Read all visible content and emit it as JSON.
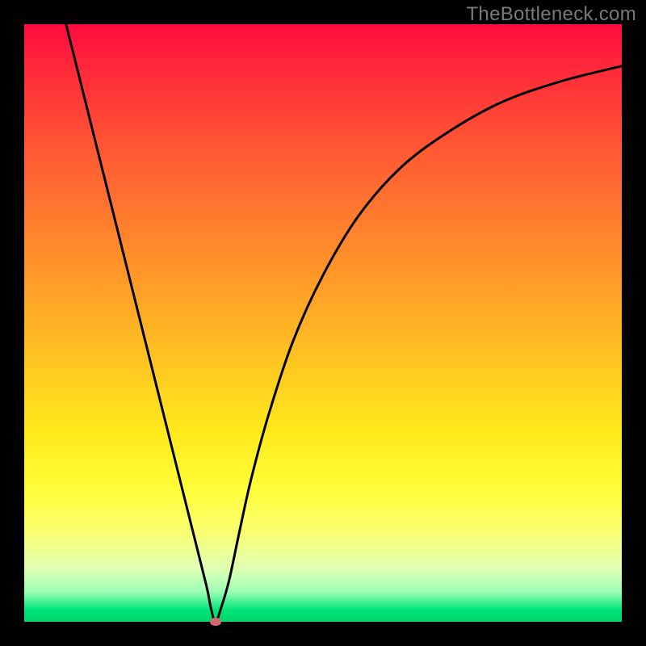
{
  "watermark": "TheBottleneck.com",
  "chart_data": {
    "type": "line",
    "title": "",
    "xlabel": "",
    "ylabel": "",
    "xlim": [
      0,
      100
    ],
    "ylim": [
      0,
      100
    ],
    "grid": false,
    "curve_x": [
      7,
      10,
      13,
      16,
      19,
      22,
      25,
      28,
      30.5,
      31.2,
      32.0,
      33.0,
      34.3,
      36,
      38,
      41,
      45,
      50,
      56,
      63,
      71,
      80,
      90,
      100
    ],
    "curve_y": [
      100,
      88,
      76,
      64,
      52,
      40,
      28,
      16,
      6,
      2.5,
      0,
      2.5,
      7,
      15,
      24,
      35,
      47,
      58,
      68,
      76,
      82,
      87,
      90.5,
      93
    ],
    "min_point": {
      "x": 32.0,
      "y": 0
    },
    "colors": {
      "curve": "#000000",
      "min_marker": "#cf6a71",
      "gradient_top": "#ff0b3f",
      "gradient_bottom": "#00d268"
    }
  }
}
